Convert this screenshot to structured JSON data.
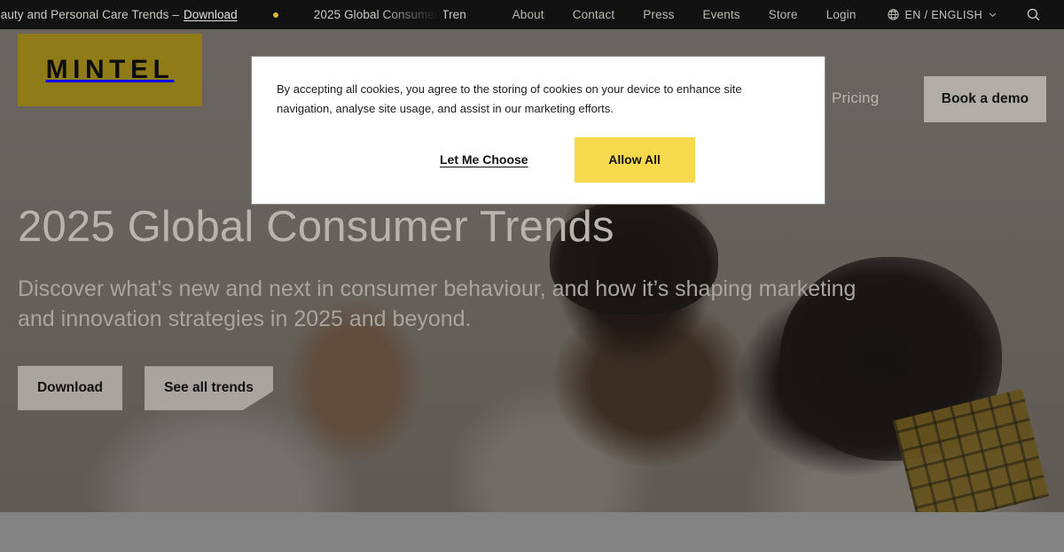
{
  "ticker": {
    "items": [
      {
        "text": "Beauty and Personal Care Trends –",
        "link_label": "Download"
      },
      {
        "text": "2025 Global Consumer Tren",
        "link_label": ""
      }
    ],
    "separator_icon": "dot-icon"
  },
  "util_nav": {
    "links": [
      {
        "label": "About"
      },
      {
        "label": "Contact"
      },
      {
        "label": "Press"
      },
      {
        "label": "Events"
      },
      {
        "label": "Store"
      },
      {
        "label": "Login"
      }
    ],
    "language": {
      "label": "EN / ENGLISH",
      "globe_icon": "globe-icon",
      "chevron_icon": "chevron-down-icon"
    },
    "search_icon": "search-icon"
  },
  "masthead": {
    "logo_text": "MINTEL",
    "logo_color": "#8f7c18",
    "pricing_label": "Pricing",
    "demo_button_label": "Book a demo"
  },
  "hero": {
    "title": "2025 Global Consumer Trends",
    "subtitle": "Discover what’s new and next in consumer behaviour, and how it’s shaping marketing and innovation strategies in 2025 and beyond.",
    "primary_cta": "Download",
    "secondary_cta": "See all trends"
  },
  "cookie_banner": {
    "body": "By accepting all cookies, you agree to the storing of cookies on your device to enhance site navigation, analyse site usage, and assist in our marketing efforts.",
    "choose_label": "Let Me Choose",
    "allow_label": "Allow All",
    "allow_color": "#f7d94e"
  }
}
